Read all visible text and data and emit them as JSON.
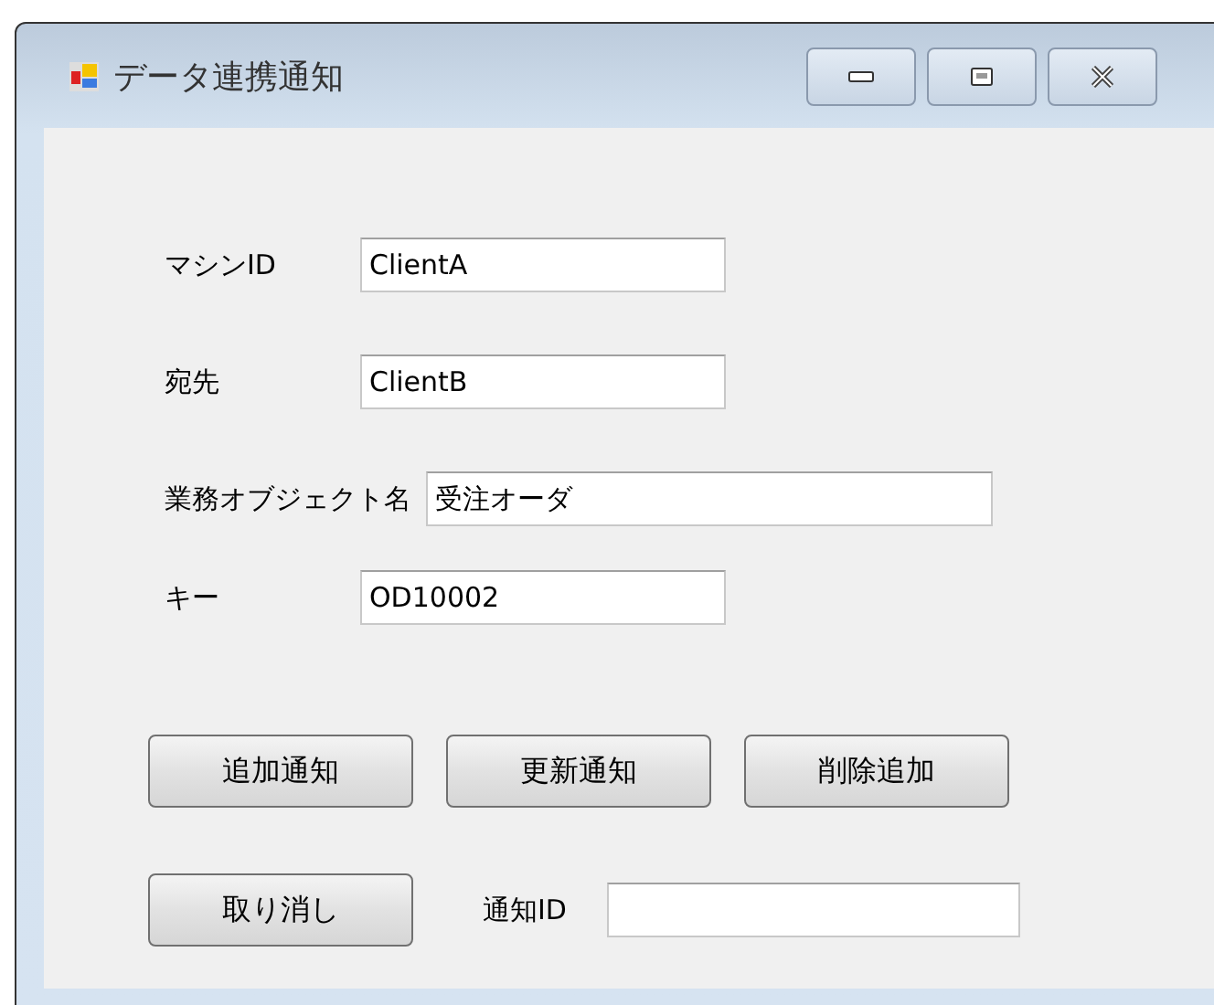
{
  "window": {
    "title": "データ連携通知"
  },
  "fields": [
    {
      "label": "マシンID",
      "value": "ClientA",
      "kind": "short"
    },
    {
      "label": "宛先",
      "value": "ClientB",
      "kind": "short"
    },
    {
      "label": "業務オブジェクト名",
      "value": "受注オーダ",
      "kind": "wide"
    },
    {
      "label": "キー",
      "value": "OD10002",
      "kind": "short"
    }
  ],
  "buttons": [
    "追加通知",
    "更新通知",
    "削除追加"
  ],
  "cancel_button": "取り消し",
  "notification_id": {
    "label": "通知ID"
  }
}
